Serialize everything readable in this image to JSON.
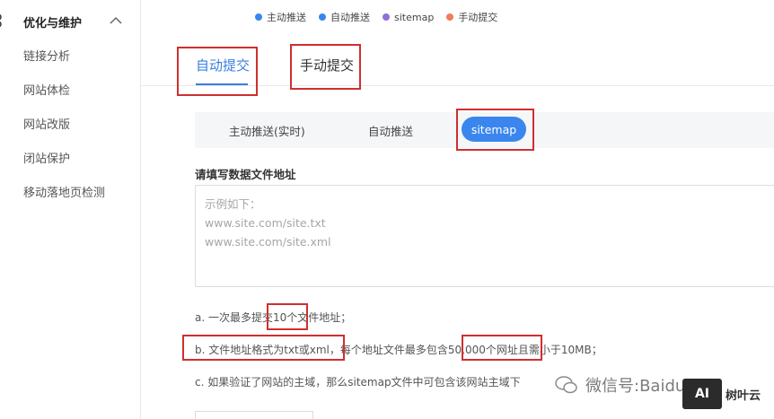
{
  "sidebar": {
    "group_title": "优化与维护",
    "items": [
      {
        "label": "链接分析"
      },
      {
        "label": "网站体检"
      },
      {
        "label": "网站改版"
      },
      {
        "label": "闭站保护"
      },
      {
        "label": "移动落地页检测"
      }
    ]
  },
  "legend": [
    {
      "label": "主动推送",
      "color": "#3a86ee"
    },
    {
      "label": "自动推送",
      "color": "#3a86ee"
    },
    {
      "label": "sitemap",
      "color": "#8e72d6"
    },
    {
      "label": "手动提交",
      "color": "#f07c5a"
    }
  ],
  "main_tabs": [
    {
      "label": "自动提交",
      "active": true
    },
    {
      "label": "手动提交",
      "active": false
    }
  ],
  "sub_tabs": [
    {
      "label": "主动推送(实时)"
    },
    {
      "label": "自动推送"
    },
    {
      "label": "sitemap",
      "active": true
    }
  ],
  "form": {
    "label": "请填写数据文件地址",
    "placeholder_lines": [
      "示例如下：",
      "www.site.com/site.txt",
      "www.site.com/site.xml"
    ]
  },
  "notes": [
    "a. 一次最多提交10个文件地址；",
    "b. 文件地址格式为txt或xml，每个地址文件最多包含50,000个网址且需小于10MB；",
    "c. 如果验证了网站的主域，那么sitemap文件中可包含该网站主域下"
  ],
  "watermark": {
    "text": "微信号:Baidu-seo",
    "brand": "树叶云",
    "logo_text": "AI"
  },
  "colors": {
    "accent": "#3a86ee",
    "highlight_box": "#cf2f2f"
  }
}
